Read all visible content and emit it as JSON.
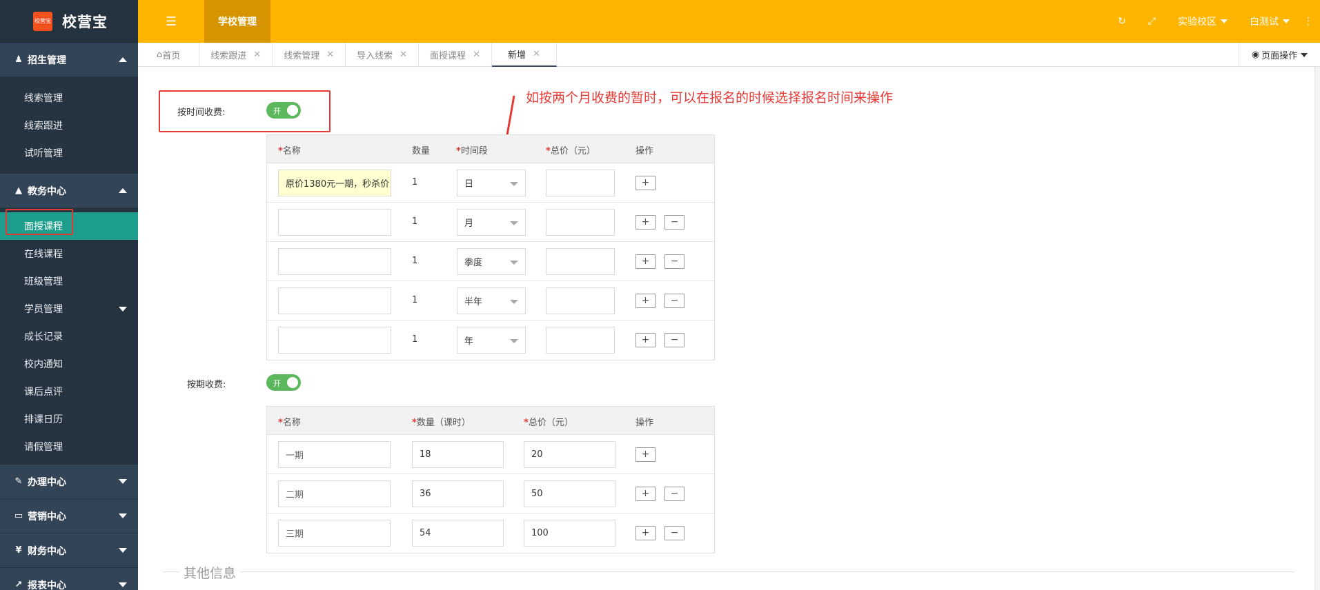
{
  "brand": {
    "logo_text": "校营宝",
    "name": "校营宝"
  },
  "sidebar": {
    "groups": [
      {
        "label": "招生管理",
        "icon": "user-icon",
        "items": [
          "线索管理",
          "线索跟进",
          "试听管理"
        ]
      },
      {
        "label": "教务中心",
        "icon": "graduation-cap-icon",
        "items": [
          "面授课程",
          "在线课程",
          "班级管理",
          "学员管理",
          "成长记录",
          "校内通知",
          "课后点评",
          "排课日历",
          "请假管理"
        ]
      },
      {
        "label": "办理中心",
        "icon": "edit-icon"
      },
      {
        "label": "营销中心",
        "icon": "laptop-icon"
      },
      {
        "label": "财务中心",
        "icon": "yen-icon"
      },
      {
        "label": "报表中心",
        "icon": "line-chart-icon"
      }
    ],
    "active_item": "面授课程"
  },
  "header": {
    "title": "学校管理",
    "campus": "实验校区",
    "user": "白测试"
  },
  "tabs": {
    "items": [
      {
        "label": "首页"
      },
      {
        "label": "线索跟进"
      },
      {
        "label": "线索管理"
      },
      {
        "label": "导入线索"
      },
      {
        "label": "面授课程"
      },
      {
        "label": "新增"
      }
    ],
    "page_ops": "页面操作"
  },
  "form": {
    "time_charge_label": "按时间收费:",
    "switch_on": "开",
    "annotation": "如按两个月收费的暂时，可以在报名的时候选择报名时间来操作",
    "time_table": {
      "headers": [
        "名称",
        "数量",
        "时间段",
        "总价（元）",
        "操作"
      ],
      "rows": [
        {
          "name": "原价1380元一期，秒杀价",
          "qty": "1",
          "period": "日",
          "price": ""
        },
        {
          "name": "",
          "qty": "1",
          "period": "月",
          "price": ""
        },
        {
          "name": "",
          "qty": "1",
          "period": "季度",
          "price": ""
        },
        {
          "name": "",
          "qty": "1",
          "period": "半年",
          "price": ""
        },
        {
          "name": "",
          "qty": "1",
          "period": "年",
          "price": ""
        }
      ]
    },
    "term_charge_label": "按期收费:",
    "term_table": {
      "headers": [
        "名称",
        "数量（课时）",
        "总价（元）",
        "操作"
      ],
      "rows": [
        {
          "name": "一期",
          "hours": "18",
          "price": "20"
        },
        {
          "name": "二期",
          "hours": "36",
          "price": "50"
        },
        {
          "name": "三期",
          "hours": "54",
          "price": "100"
        }
      ]
    },
    "other_info": "其他信息"
  },
  "colors": {
    "header": "#ffb400",
    "sidebar": "#2f3d4d",
    "active": "#1e9f8d",
    "switch": "#5cb85c",
    "annotation": "#e53935"
  }
}
